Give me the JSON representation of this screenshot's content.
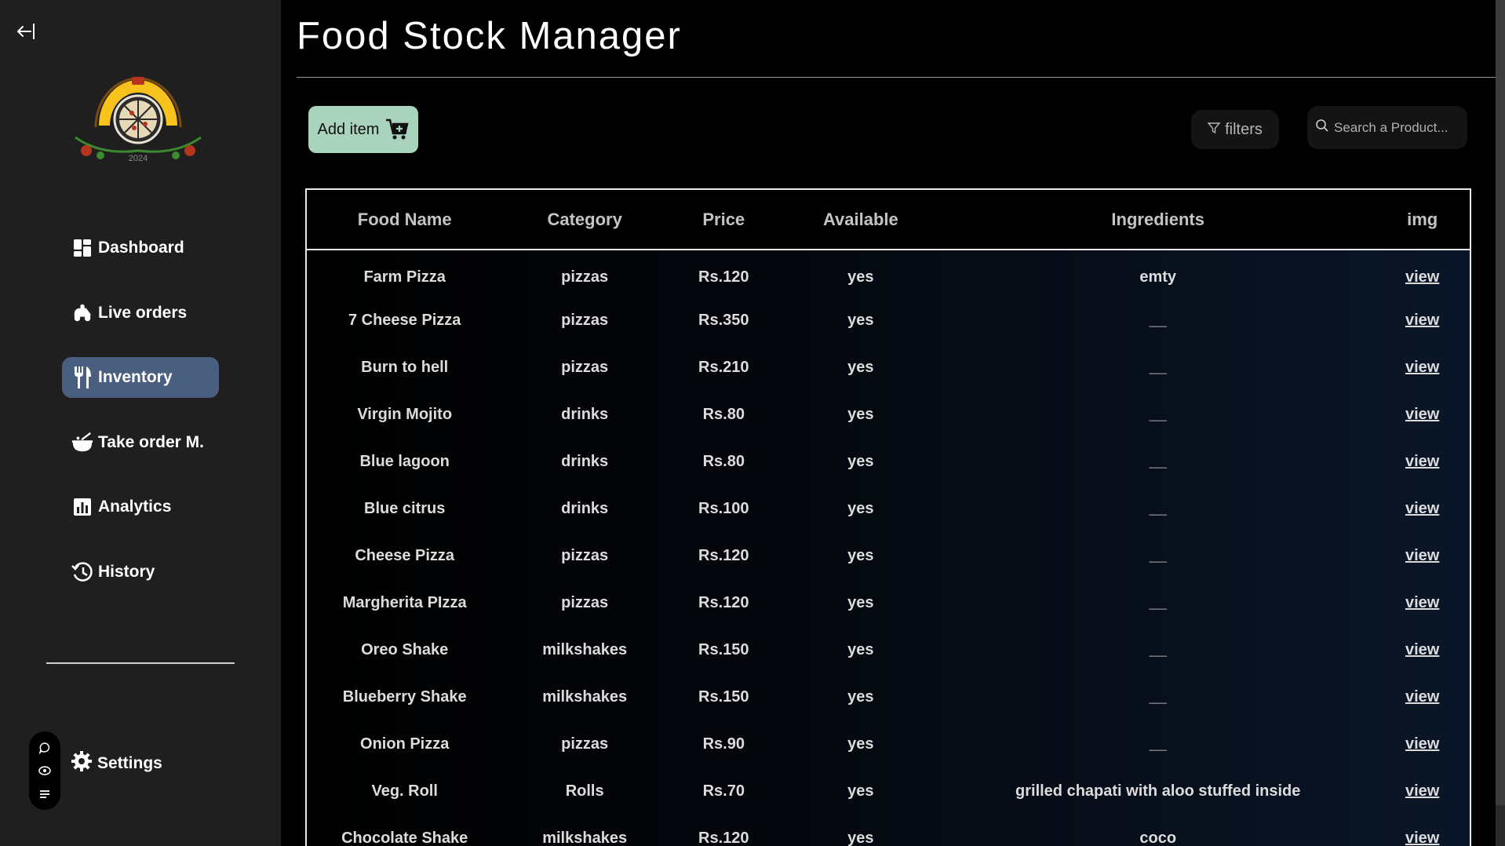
{
  "app": {
    "title": "Food Stock Manager",
    "accent_color": "#4a5e80",
    "add_button_color": "#a9d3bd"
  },
  "sidebar": {
    "logo_year": "2024",
    "items": [
      {
        "label": "Dashboard",
        "icon": "dashboard-icon",
        "active": false
      },
      {
        "label": "Live orders",
        "icon": "delivery-icon",
        "active": false
      },
      {
        "label": "Inventory",
        "icon": "fork-knife-icon",
        "active": true
      },
      {
        "label": "Take order M.",
        "icon": "bowl-icon",
        "active": false
      },
      {
        "label": "Analytics",
        "icon": "chart-icon",
        "active": false
      },
      {
        "label": "History",
        "icon": "history-icon",
        "active": false
      }
    ],
    "settings_label": "Settings"
  },
  "toolbar": {
    "add_label": "Add item",
    "filters_label": "filters",
    "search_placeholder": "Search a Product..."
  },
  "table": {
    "headers": [
      "Food Name",
      "Category",
      "Price",
      "Available",
      "Ingredients",
      "img"
    ],
    "rows": [
      {
        "name": "Farm Pizza",
        "category": "pizzas",
        "price": "Rs.120",
        "available": "yes",
        "ingredients": "emty",
        "img": "view"
      },
      {
        "name": "7 Cheese Pizza",
        "category": "pizzas",
        "price": "Rs.350",
        "available": "yes",
        "ingredients": "__",
        "img": "view"
      },
      {
        "name": "Burn to hell",
        "category": "pizzas",
        "price": "Rs.210",
        "available": "yes",
        "ingredients": "__",
        "img": "view"
      },
      {
        "name": "Virgin Mojito",
        "category": "drinks",
        "price": "Rs.80",
        "available": "yes",
        "ingredients": "__",
        "img": "view"
      },
      {
        "name": "Blue lagoon",
        "category": "drinks",
        "price": "Rs.80",
        "available": "yes",
        "ingredients": "__",
        "img": "view"
      },
      {
        "name": "Blue citrus",
        "category": "drinks",
        "price": "Rs.100",
        "available": "yes",
        "ingredients": "__",
        "img": "view"
      },
      {
        "name": "Cheese Pizza",
        "category": "pizzas",
        "price": "Rs.120",
        "available": "yes",
        "ingredients": "__",
        "img": "view"
      },
      {
        "name": "Margherita PIzza",
        "category": "pizzas",
        "price": "Rs.120",
        "available": "yes",
        "ingredients": "__",
        "img": "view"
      },
      {
        "name": "Oreo Shake",
        "category": "milkshakes",
        "price": "Rs.150",
        "available": "yes",
        "ingredients": "__",
        "img": "view"
      },
      {
        "name": "Blueberry Shake",
        "category": "milkshakes",
        "price": "Rs.150",
        "available": "yes",
        "ingredients": "__",
        "img": "view"
      },
      {
        "name": "Onion Pizza",
        "category": "pizzas",
        "price": "Rs.90",
        "available": "yes",
        "ingredients": "__",
        "img": "view"
      },
      {
        "name": "Veg. Roll",
        "category": "Rolls",
        "price": "Rs.70",
        "available": "yes",
        "ingredients": "grilled chapati with aloo stuffed inside",
        "img": "view"
      },
      {
        "name": "Chocolate Shake",
        "category": "milkshakes",
        "price": "Rs.120",
        "available": "yes",
        "ingredients": "coco",
        "img": "view"
      }
    ]
  }
}
